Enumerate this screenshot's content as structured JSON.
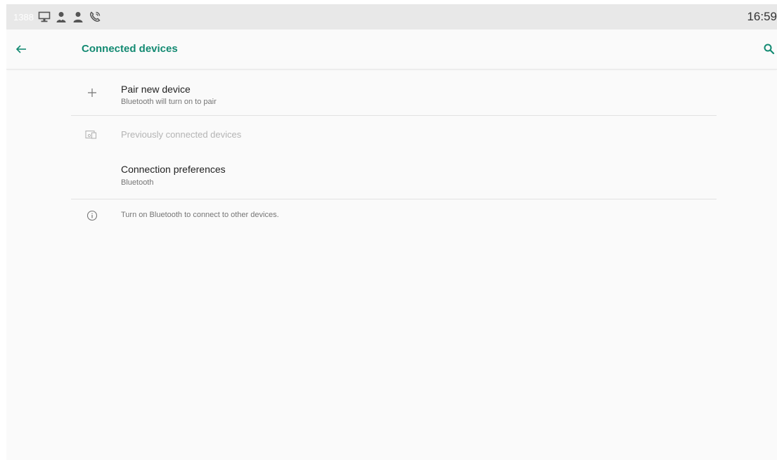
{
  "status_bar": {
    "extension": "1388",
    "time": "16:59",
    "icons": [
      "monitor-icon",
      "user-icon",
      "user-icon",
      "phone-call-icon"
    ]
  },
  "app_bar": {
    "title": "Connected devices",
    "back_icon": "arrow-back-icon",
    "search_icon": "search-icon"
  },
  "list": {
    "pair_new_device": {
      "title": "Pair new device",
      "summary": "Bluetooth will turn on to pair",
      "icon": "plus-icon"
    },
    "previously_connected": {
      "title": "Previously connected devices",
      "icon": "devices-icon",
      "enabled": false
    },
    "connection_preferences": {
      "title": "Connection preferences",
      "summary": "Bluetooth"
    },
    "footer": {
      "text": "Turn on Bluetooth to connect to other devices.",
      "icon": "info-icon"
    }
  },
  "colors": {
    "accent": "#138a72",
    "background": "#fafafa",
    "status_bar": "#e8e8e8"
  }
}
